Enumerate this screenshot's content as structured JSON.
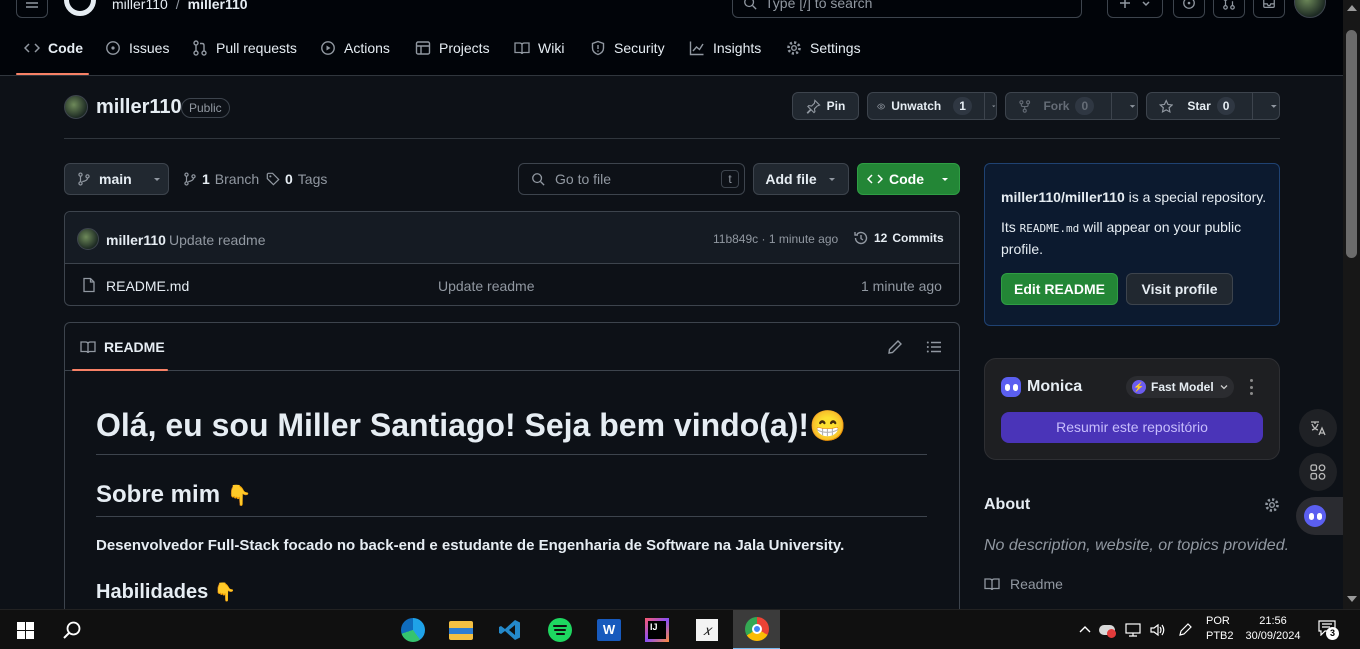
{
  "header": {
    "owner": "miller110",
    "separator": "/",
    "repo": "miller110",
    "search_placeholder": "Type [/] to search"
  },
  "tabs": [
    {
      "label": "Code",
      "icon": "code-icon",
      "active": true
    },
    {
      "label": "Issues",
      "icon": "issue-icon"
    },
    {
      "label": "Pull requests",
      "icon": "pull-request-icon"
    },
    {
      "label": "Actions",
      "icon": "play-icon"
    },
    {
      "label": "Projects",
      "icon": "table-icon"
    },
    {
      "label": "Wiki",
      "icon": "book-icon"
    },
    {
      "label": "Security",
      "icon": "shield-icon"
    },
    {
      "label": "Insights",
      "icon": "graph-icon"
    },
    {
      "label": "Settings",
      "icon": "gear-icon"
    }
  ],
  "repo": {
    "name": "miller110",
    "visibility": "Public",
    "pin_label": "Pin",
    "unwatch_label": "Unwatch",
    "unwatch_count": "1",
    "fork_label": "Fork",
    "fork_count": "0",
    "star_label": "Star",
    "star_count": "0"
  },
  "toolbar": {
    "branch": "main",
    "branch_count": "1",
    "branch_label": "Branch",
    "tag_count": "0",
    "tag_label": "Tags",
    "goto_placeholder": "Go to file",
    "goto_shortcut": "t",
    "add_file": "Add file",
    "code": "Code"
  },
  "commit": {
    "author": "miller110",
    "message": "Update readme",
    "hash_time": "11b849c · 1 minute ago",
    "commits_count": "12",
    "commits_label": "Commits"
  },
  "files": [
    {
      "name": "README.md",
      "message": "Update readme",
      "time": "1 minute ago"
    }
  ],
  "readme": {
    "tab_label": "README",
    "h1": "Olá, eu sou Miller Santiago! Seja bem vindo(a)!",
    "h1_emoji": "😁",
    "h2_about": "Sobre mim",
    "pointing_emoji": "👇",
    "about_text": "Desenvolvedor Full-Stack focado no back-end e estudante de Engenharia de Software na Jala University.",
    "h2_skills": "Habilidades"
  },
  "special": {
    "repo_full": "miller110/miller110",
    "text1": " is a special repository.",
    "its": "Its ",
    "file": "README.md",
    "text2": " will appear on your public profile.",
    "edit_readme": "Edit README",
    "visit_profile": "Visit profile"
  },
  "monica": {
    "name": "Monica",
    "model": "Fast Model",
    "summarize": "Resumir este repositório"
  },
  "about": {
    "title": "About",
    "description": "No description, website, or topics provided.",
    "readme_link": "Readme"
  },
  "taskbar": {
    "lang1": "POR",
    "lang2": "PTB2",
    "time": "21:56",
    "date": "30/09/2024",
    "notification_count": "3"
  },
  "colors": {
    "bg": "#0d1117",
    "header_bg": "#010409",
    "border": "#3d444d",
    "green": "#238636",
    "accent_underline": "#f78166",
    "monica_purple": "#5b3fc7"
  }
}
